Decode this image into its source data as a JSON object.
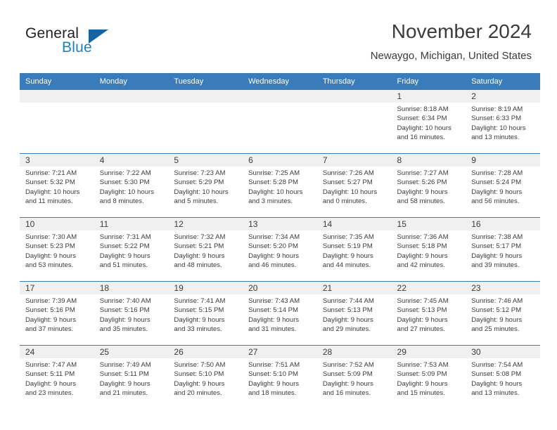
{
  "brand": {
    "name_part1": "General",
    "name_part2": "Blue",
    "triangle_color": "#1565a6",
    "blue_color": "#1b7fc4"
  },
  "header": {
    "title": "November 2024",
    "subtitle": "Newaygo, Michigan, United States"
  },
  "calendar": {
    "header_bg": "#3a7cba",
    "daynum_bg": "#f0f0f0",
    "weekday_headers": [
      "Sunday",
      "Monday",
      "Tuesday",
      "Wednesday",
      "Thursday",
      "Friday",
      "Saturday"
    ],
    "weeks": [
      [
        {
          "day": "",
          "empty": true
        },
        {
          "day": "",
          "empty": true
        },
        {
          "day": "",
          "empty": true
        },
        {
          "day": "",
          "empty": true
        },
        {
          "day": "",
          "empty": true
        },
        {
          "day": "1",
          "sunrise": "Sunrise: 8:18 AM",
          "sunset": "Sunset: 6:34 PM",
          "daylight1": "Daylight: 10 hours",
          "daylight2": "and 16 minutes."
        },
        {
          "day": "2",
          "sunrise": "Sunrise: 8:19 AM",
          "sunset": "Sunset: 6:33 PM",
          "daylight1": "Daylight: 10 hours",
          "daylight2": "and 13 minutes."
        }
      ],
      [
        {
          "day": "3",
          "sunrise": "Sunrise: 7:21 AM",
          "sunset": "Sunset: 5:32 PM",
          "daylight1": "Daylight: 10 hours",
          "daylight2": "and 11 minutes."
        },
        {
          "day": "4",
          "sunrise": "Sunrise: 7:22 AM",
          "sunset": "Sunset: 5:30 PM",
          "daylight1": "Daylight: 10 hours",
          "daylight2": "and 8 minutes."
        },
        {
          "day": "5",
          "sunrise": "Sunrise: 7:23 AM",
          "sunset": "Sunset: 5:29 PM",
          "daylight1": "Daylight: 10 hours",
          "daylight2": "and 5 minutes."
        },
        {
          "day": "6",
          "sunrise": "Sunrise: 7:25 AM",
          "sunset": "Sunset: 5:28 PM",
          "daylight1": "Daylight: 10 hours",
          "daylight2": "and 3 minutes."
        },
        {
          "day": "7",
          "sunrise": "Sunrise: 7:26 AM",
          "sunset": "Sunset: 5:27 PM",
          "daylight1": "Daylight: 10 hours",
          "daylight2": "and 0 minutes."
        },
        {
          "day": "8",
          "sunrise": "Sunrise: 7:27 AM",
          "sunset": "Sunset: 5:26 PM",
          "daylight1": "Daylight: 9 hours",
          "daylight2": "and 58 minutes."
        },
        {
          "day": "9",
          "sunrise": "Sunrise: 7:28 AM",
          "sunset": "Sunset: 5:24 PM",
          "daylight1": "Daylight: 9 hours",
          "daylight2": "and 56 minutes."
        }
      ],
      [
        {
          "day": "10",
          "sunrise": "Sunrise: 7:30 AM",
          "sunset": "Sunset: 5:23 PM",
          "daylight1": "Daylight: 9 hours",
          "daylight2": "and 53 minutes."
        },
        {
          "day": "11",
          "sunrise": "Sunrise: 7:31 AM",
          "sunset": "Sunset: 5:22 PM",
          "daylight1": "Daylight: 9 hours",
          "daylight2": "and 51 minutes."
        },
        {
          "day": "12",
          "sunrise": "Sunrise: 7:32 AM",
          "sunset": "Sunset: 5:21 PM",
          "daylight1": "Daylight: 9 hours",
          "daylight2": "and 48 minutes."
        },
        {
          "day": "13",
          "sunrise": "Sunrise: 7:34 AM",
          "sunset": "Sunset: 5:20 PM",
          "daylight1": "Daylight: 9 hours",
          "daylight2": "and 46 minutes."
        },
        {
          "day": "14",
          "sunrise": "Sunrise: 7:35 AM",
          "sunset": "Sunset: 5:19 PM",
          "daylight1": "Daylight: 9 hours",
          "daylight2": "and 44 minutes."
        },
        {
          "day": "15",
          "sunrise": "Sunrise: 7:36 AM",
          "sunset": "Sunset: 5:18 PM",
          "daylight1": "Daylight: 9 hours",
          "daylight2": "and 42 minutes."
        },
        {
          "day": "16",
          "sunrise": "Sunrise: 7:38 AM",
          "sunset": "Sunset: 5:17 PM",
          "daylight1": "Daylight: 9 hours",
          "daylight2": "and 39 minutes."
        }
      ],
      [
        {
          "day": "17",
          "sunrise": "Sunrise: 7:39 AM",
          "sunset": "Sunset: 5:16 PM",
          "daylight1": "Daylight: 9 hours",
          "daylight2": "and 37 minutes."
        },
        {
          "day": "18",
          "sunrise": "Sunrise: 7:40 AM",
          "sunset": "Sunset: 5:16 PM",
          "daylight1": "Daylight: 9 hours",
          "daylight2": "and 35 minutes."
        },
        {
          "day": "19",
          "sunrise": "Sunrise: 7:41 AM",
          "sunset": "Sunset: 5:15 PM",
          "daylight1": "Daylight: 9 hours",
          "daylight2": "and 33 minutes."
        },
        {
          "day": "20",
          "sunrise": "Sunrise: 7:43 AM",
          "sunset": "Sunset: 5:14 PM",
          "daylight1": "Daylight: 9 hours",
          "daylight2": "and 31 minutes."
        },
        {
          "day": "21",
          "sunrise": "Sunrise: 7:44 AM",
          "sunset": "Sunset: 5:13 PM",
          "daylight1": "Daylight: 9 hours",
          "daylight2": "and 29 minutes."
        },
        {
          "day": "22",
          "sunrise": "Sunrise: 7:45 AM",
          "sunset": "Sunset: 5:13 PM",
          "daylight1": "Daylight: 9 hours",
          "daylight2": "and 27 minutes."
        },
        {
          "day": "23",
          "sunrise": "Sunrise: 7:46 AM",
          "sunset": "Sunset: 5:12 PM",
          "daylight1": "Daylight: 9 hours",
          "daylight2": "and 25 minutes."
        }
      ],
      [
        {
          "day": "24",
          "sunrise": "Sunrise: 7:47 AM",
          "sunset": "Sunset: 5:11 PM",
          "daylight1": "Daylight: 9 hours",
          "daylight2": "and 23 minutes."
        },
        {
          "day": "25",
          "sunrise": "Sunrise: 7:49 AM",
          "sunset": "Sunset: 5:11 PM",
          "daylight1": "Daylight: 9 hours",
          "daylight2": "and 21 minutes."
        },
        {
          "day": "26",
          "sunrise": "Sunrise: 7:50 AM",
          "sunset": "Sunset: 5:10 PM",
          "daylight1": "Daylight: 9 hours",
          "daylight2": "and 20 minutes."
        },
        {
          "day": "27",
          "sunrise": "Sunrise: 7:51 AM",
          "sunset": "Sunset: 5:10 PM",
          "daylight1": "Daylight: 9 hours",
          "daylight2": "and 18 minutes."
        },
        {
          "day": "28",
          "sunrise": "Sunrise: 7:52 AM",
          "sunset": "Sunset: 5:09 PM",
          "daylight1": "Daylight: 9 hours",
          "daylight2": "and 16 minutes."
        },
        {
          "day": "29",
          "sunrise": "Sunrise: 7:53 AM",
          "sunset": "Sunset: 5:09 PM",
          "daylight1": "Daylight: 9 hours",
          "daylight2": "and 15 minutes."
        },
        {
          "day": "30",
          "sunrise": "Sunrise: 7:54 AM",
          "sunset": "Sunset: 5:08 PM",
          "daylight1": "Daylight: 9 hours",
          "daylight2": "and 13 minutes."
        }
      ]
    ]
  }
}
